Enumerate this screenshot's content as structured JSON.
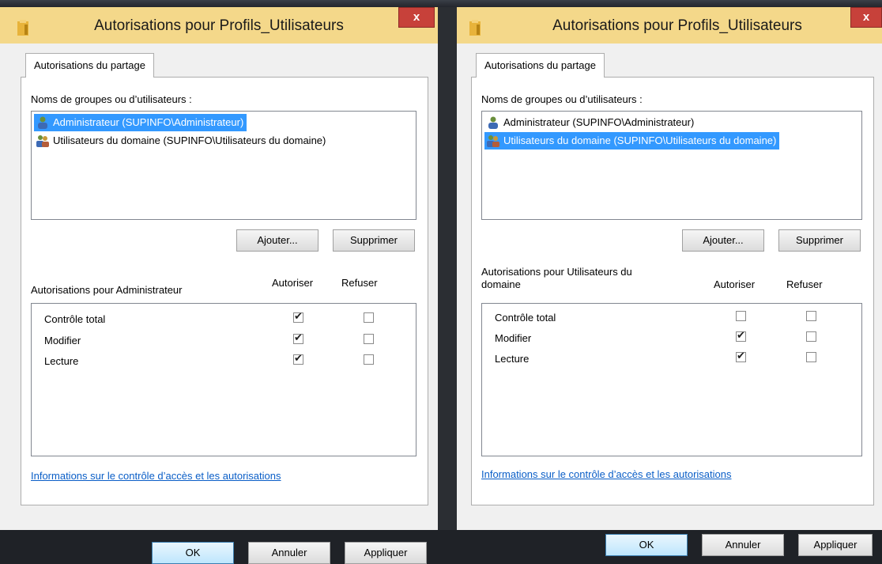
{
  "left_dialog": {
    "title": "Autorisations pour Profils_Utilisateurs",
    "close_label": "x",
    "tab_label": "Autorisations du partage",
    "groups_label": "Noms de groupes ou d’utilisateurs :",
    "users": [
      {
        "label": "Administrateur (SUPINFO\\Administrateur)",
        "selected": true
      },
      {
        "label": "Utilisateurs du domaine (SUPINFO\\Utilisateurs du domaine)",
        "selected": false
      }
    ],
    "add_label": "Ajouter...",
    "remove_label": "Supprimer",
    "perms_for_label": "Autorisations pour Administrateur",
    "allow_label": "Autoriser",
    "deny_label": "Refuser",
    "permissions": [
      {
        "label": "Contrôle total",
        "allow": true,
        "deny": false
      },
      {
        "label": "Modifier",
        "allow": true,
        "deny": false
      },
      {
        "label": "Lecture",
        "allow": true,
        "deny": false
      }
    ],
    "help_link": "Informations sur le contrôle d’accès et les autorisations",
    "ok_label": "OK",
    "cancel_label": "Annuler",
    "apply_label": "Appliquer"
  },
  "right_dialog": {
    "title": "Autorisations pour Profils_Utilisateurs",
    "close_label": "x",
    "tab_label": "Autorisations du partage",
    "groups_label": "Noms de groupes ou d’utilisateurs :",
    "users": [
      {
        "label": "Administrateur (SUPINFO\\Administrateur)",
        "selected": false
      },
      {
        "label": "Utilisateurs du domaine (SUPINFO\\Utilisateurs du domaine)",
        "selected": true
      }
    ],
    "add_label": "Ajouter...",
    "remove_label": "Supprimer",
    "perms_for_label_line1": "Autorisations pour Utilisateurs du",
    "perms_for_label_line2": "domaine",
    "allow_label": "Autoriser",
    "deny_label": "Refuser",
    "permissions": [
      {
        "label": "Contrôle total",
        "allow": false,
        "deny": false
      },
      {
        "label": "Modifier",
        "allow": true,
        "deny": false
      },
      {
        "label": "Lecture",
        "allow": true,
        "deny": false
      }
    ],
    "help_link": "Informations sur le contrôle d’accès et les autorisations",
    "ok_label": "OK",
    "cancel_label": "Annuler",
    "apply_label": "Appliquer"
  },
  "colors": {
    "titlebar": "#f4d88a",
    "selection": "#3399ff",
    "close": "#c7413a",
    "link": "#0a5ec7"
  }
}
